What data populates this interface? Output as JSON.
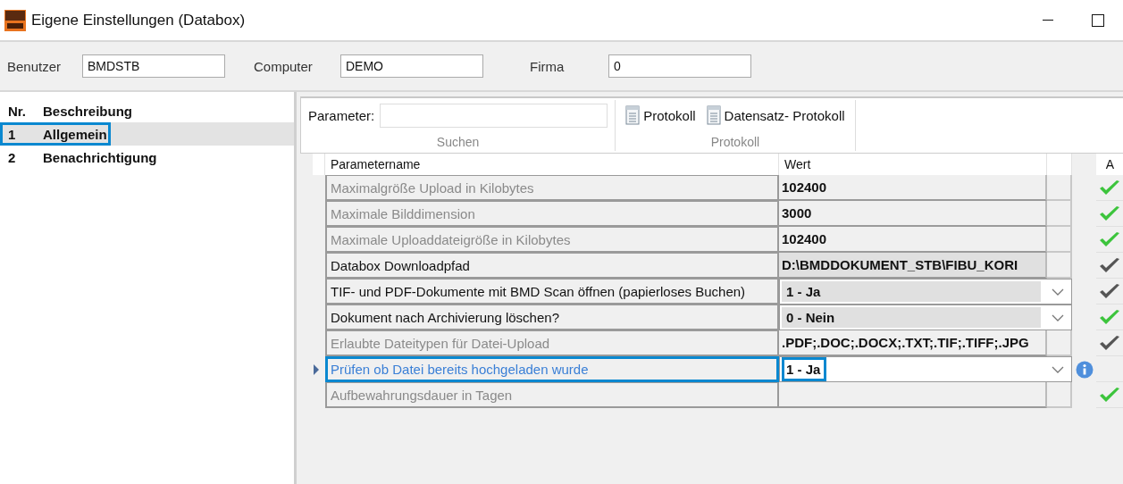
{
  "window": {
    "title": "Eigene Einstellungen (Databox)"
  },
  "context": [
    {
      "label": "Benutzer",
      "value": "BMDSTB"
    },
    {
      "label": "Computer",
      "value": "DEMO"
    },
    {
      "label": "Firma",
      "value": "0"
    }
  ],
  "list": {
    "columns": [
      "Nr.",
      "Beschreibung"
    ],
    "items": [
      {
        "nr": "1",
        "label": "Allgemein",
        "selected": true
      },
      {
        "nr": "2",
        "label": "Benachrichtigung",
        "selected": false
      }
    ]
  },
  "toolbar": {
    "search": {
      "label": "Parameter:",
      "group": "Suchen"
    },
    "protocol": {
      "buttons": [
        "Protokoll",
        "Datensatz- Protokoll"
      ],
      "group": "Protokoll"
    }
  },
  "table": {
    "columns": [
      "Parametername",
      "Wert",
      "A"
    ],
    "rows": [
      {
        "name": "Maximalgröße Upload in Kilobytes",
        "value": "102400",
        "kind": "text",
        "enabled": false,
        "selected": false,
        "check": {
          "color": "#3cc43c"
        }
      },
      {
        "name": "Maximale Bilddimension",
        "value": "3000",
        "kind": "text",
        "enabled": false,
        "selected": false,
        "check": {
          "color": "#3cc43c"
        }
      },
      {
        "name": "Maximale Uploaddateigröße in Kilobytes",
        "value": "102400",
        "kind": "text",
        "enabled": false,
        "selected": false,
        "check": {
          "color": "#3cc43c"
        }
      },
      {
        "name": "Databox Downloadpfad",
        "value": "D:\\BMDDOKUMENT_STB\\FIBU_KORI",
        "kind": "text",
        "enabled": true,
        "selected": false,
        "check": {
          "color": "#555555"
        }
      },
      {
        "name": "TIF- und PDF-Dokumente mit BMD Scan öffnen (papierloses Buchen)",
        "value": "1 - Ja",
        "kind": "dropdown",
        "enabled": true,
        "selected": false,
        "check": {
          "color": "#555555"
        }
      },
      {
        "name": "Dokument nach Archivierung löschen?",
        "value": "0 - Nein",
        "kind": "dropdown",
        "enabled": true,
        "selected": false,
        "check": {
          "color": "#3cc43c"
        }
      },
      {
        "name": "Erlaubte Dateitypen für Datei-Upload",
        "value": ".PDF;.DOC;.DOCX;.TXT;.TIF;.TIFF;.JPG",
        "kind": "text",
        "enabled": false,
        "selected": false,
        "check": {
          "color": "#555555"
        }
      },
      {
        "name": "Prüfen ob Datei bereits hochgeladen wurde",
        "value": "1 - Ja",
        "kind": "dropdown",
        "enabled": true,
        "selected": true,
        "info": true
      },
      {
        "name": "Aufbewahrungsdauer in Tagen",
        "kind": "text",
        "enabled": false,
        "selected": false,
        "check": {
          "color": "#3cc43c"
        }
      }
    ]
  }
}
